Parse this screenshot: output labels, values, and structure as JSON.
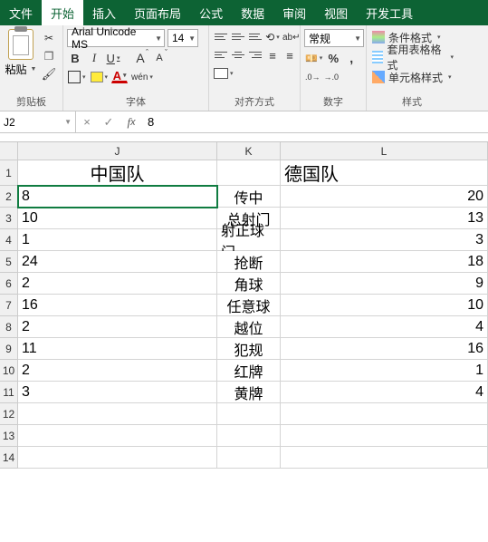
{
  "menubar": {
    "items": [
      "文件",
      "开始",
      "插入",
      "页面布局",
      "公式",
      "数据",
      "审阅",
      "视图",
      "开发工具"
    ],
    "active_index": 1
  },
  "ribbon": {
    "clipboard": {
      "paste_label": "粘贴",
      "group_label": "剪贴板"
    },
    "font": {
      "group_label": "字体",
      "name": "Arial Unicode MS",
      "size": "14",
      "phonetic": "wén"
    },
    "align": {
      "group_label": "对齐方式"
    },
    "number": {
      "group_label": "数字",
      "format": "常规"
    },
    "styles": {
      "group_label": "样式",
      "cond_fmt": "条件格式",
      "table_fmt": "套用表格格式",
      "cell_style": "单元格样式"
    }
  },
  "namebar": {
    "ref": "J2",
    "formula": "8"
  },
  "grid": {
    "columns": [
      "J",
      "K",
      "L"
    ],
    "row_numbers": [
      "1",
      "2",
      "3",
      "4",
      "5",
      "6",
      "7",
      "8",
      "9",
      "10",
      "11",
      "12",
      "13",
      "14"
    ],
    "header_row": {
      "J": "中国队",
      "K": "",
      "L": "德国队"
    },
    "rows": [
      {
        "J": "8",
        "K": "传中",
        "L": "20"
      },
      {
        "J": "10",
        "K": "总射门",
        "L": "13"
      },
      {
        "J": "1",
        "K": "射正球门",
        "L": "3"
      },
      {
        "J": "24",
        "K": "抢断",
        "L": "18"
      },
      {
        "J": "2",
        "K": "角球",
        "L": "9"
      },
      {
        "J": "16",
        "K": "任意球",
        "L": "10"
      },
      {
        "J": "2",
        "K": "越位",
        "L": "4"
      },
      {
        "J": "11",
        "K": "犯规",
        "L": "16"
      },
      {
        "J": "2",
        "K": "红牌",
        "L": "1"
      },
      {
        "J": "3",
        "K": "黄牌",
        "L": "4"
      }
    ],
    "selected": "J2"
  },
  "chart_data": {
    "type": "table",
    "title": "",
    "columns": [
      "中国队",
      "",
      "德国队"
    ],
    "series": [
      {
        "name": "中国队",
        "values": [
          8,
          10,
          1,
          24,
          2,
          16,
          2,
          11,
          2,
          3
        ]
      },
      {
        "name": "德国队",
        "values": [
          20,
          13,
          3,
          18,
          9,
          10,
          4,
          16,
          1,
          4
        ]
      }
    ],
    "categories": [
      "传中",
      "总射门",
      "射正球门",
      "抢断",
      "角球",
      "任意球",
      "越位",
      "犯规",
      "红牌",
      "黄牌"
    ]
  }
}
